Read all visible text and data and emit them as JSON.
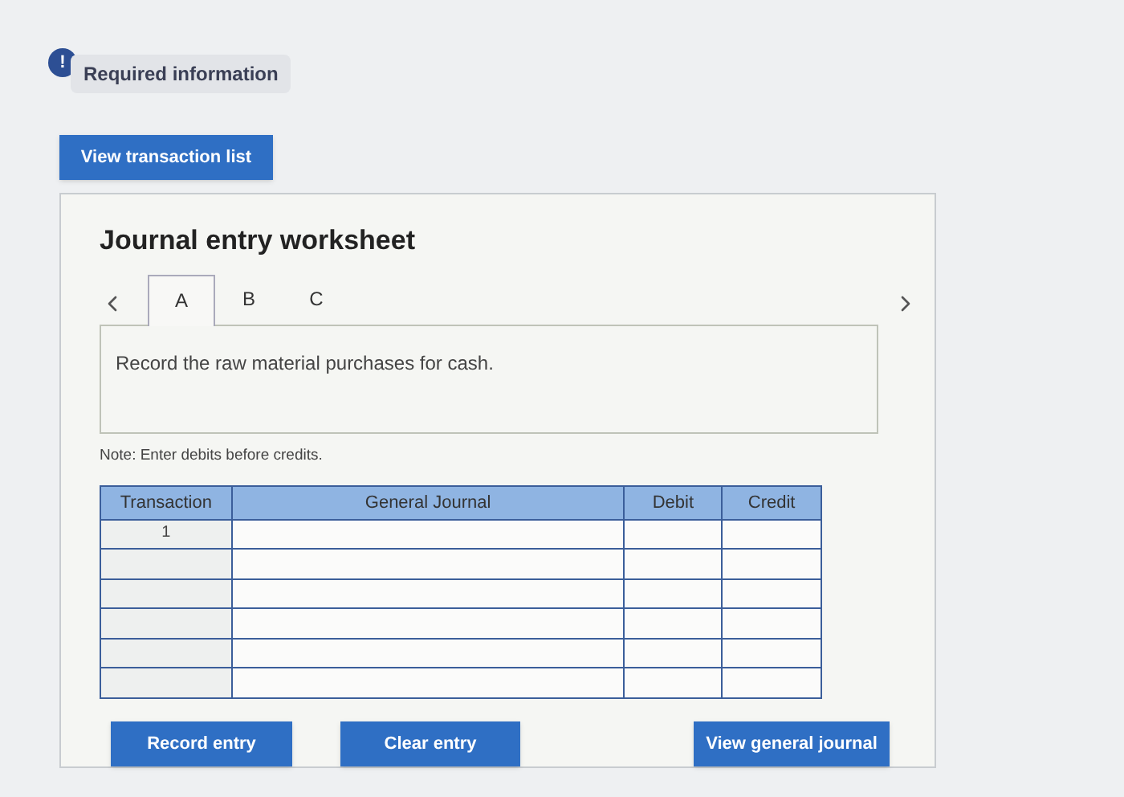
{
  "required_information": {
    "label": "Required information",
    "icon": "!"
  },
  "view_transaction_list": "View transaction list",
  "worksheet": {
    "title": "Journal entry worksheet",
    "tabs": [
      {
        "label": "A",
        "selected": true
      },
      {
        "label": "B",
        "selected": false
      },
      {
        "label": "C",
        "selected": false
      }
    ],
    "instruction": "Record the raw material purchases for cash.",
    "note": "Note: Enter debits before credits.",
    "table": {
      "columns": [
        "Transaction",
        "General Journal",
        "Debit",
        "Credit"
      ],
      "rows": [
        {
          "transaction": "1"
        },
        {
          "transaction": ""
        },
        {
          "transaction": ""
        },
        {
          "transaction": ""
        },
        {
          "transaction": ""
        },
        {
          "transaction": ""
        }
      ]
    },
    "buttons": [
      "Record entry",
      "Clear entry",
      "View general journal"
    ]
  }
}
